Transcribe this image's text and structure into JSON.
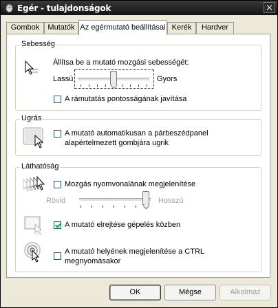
{
  "window": {
    "title": "Egér - tulajdonságok"
  },
  "tabs": [
    {
      "label": "Gombok"
    },
    {
      "label": "Mutatók"
    },
    {
      "label": "Az egérmutató beállításai",
      "active": true
    },
    {
      "label": "Kerék"
    },
    {
      "label": "Hardver"
    }
  ],
  "speed": {
    "legend": "Sebesség",
    "instruction": "Állítsa be a mutató mozgási sebességét:",
    "slow_label": "Lassú",
    "fast_label": "Gyors",
    "slider_level": 0.5,
    "precision_label": "A rámutatás pontosságának javítása",
    "precision_checked": false
  },
  "snap": {
    "legend": "Ugrás",
    "label_line1": "A mutató automatikusan a párbeszédpanel",
    "label_line2": "alapértelmezett gombjára ugrik",
    "checked": false
  },
  "visibility": {
    "legend": "Láthatóság",
    "trails_label": "Mozgás nyomvonalának megjelenítése",
    "trails_checked": false,
    "short_label": "Rövid",
    "long_label": "Hosszú",
    "trails_level": 1.0,
    "hide_label": "A mutató elrejtése gépelés közben",
    "hide_checked": true,
    "ctrl_line1": "A mutató helyének megjelenítése a CTRL",
    "ctrl_line2": "megnyomásakor",
    "ctrl_checked": false
  },
  "buttons": {
    "ok": "OK",
    "cancel": "Mégse",
    "apply": "Alkalmaz"
  },
  "icons": {
    "title": "mouse-icon",
    "speed": "pointer-speed-icon",
    "snap": "snap-to-default-icon",
    "trails": "pointer-trails-icon",
    "hide": "hide-pointer-icon",
    "ctrl": "locate-pointer-icon"
  }
}
